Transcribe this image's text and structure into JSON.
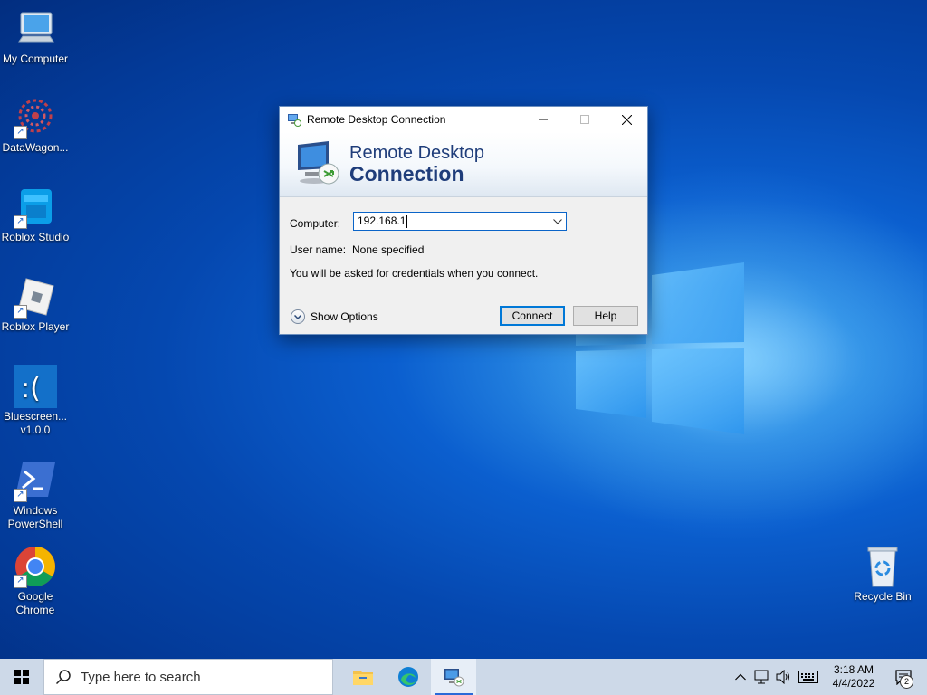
{
  "desktop": {
    "icons": [
      {
        "label": "My Computer"
      },
      {
        "label": "DataWagon..."
      },
      {
        "label": "Roblox Studio"
      },
      {
        "label": "Roblox Player"
      },
      {
        "label_line1": "Bluescreen...",
        "label_line2": "v1.0.0"
      },
      {
        "label_line1": "Windows",
        "label_line2": "PowerShell"
      },
      {
        "label_line1": "Google",
        "label_line2": "Chrome"
      },
      {
        "label": "Recycle Bin"
      }
    ]
  },
  "dialog": {
    "title": "Remote Desktop Connection",
    "banner_line1": "Remote Desktop",
    "banner_line2": "Connection",
    "computer_label": "Computer:",
    "computer_value": "192.168.1",
    "username_label": "User name:",
    "username_value": "None specified",
    "credentials_note": "You will be asked for credentials when you connect.",
    "show_options": "Show Options",
    "connect_button": "Connect",
    "help_button": "Help"
  },
  "taskbar": {
    "search_placeholder": "Type here to search",
    "time": "3:18 AM",
    "date": "4/4/2022",
    "notification_count": "2"
  },
  "colors": {
    "accent": "#0078d7",
    "banner_text": "#1f3d7a",
    "taskbar": "#cdd9e8"
  }
}
